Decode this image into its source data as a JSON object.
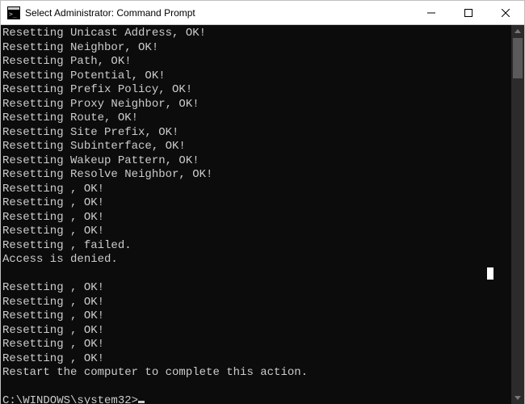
{
  "titlebar": {
    "title": "Select Administrator: Command Prompt"
  },
  "console": {
    "lines": [
      "Resetting Unicast Address, OK!",
      "Resetting Neighbor, OK!",
      "Resetting Path, OK!",
      "Resetting Potential, OK!",
      "Resetting Prefix Policy, OK!",
      "Resetting Proxy Neighbor, OK!",
      "Resetting Route, OK!",
      "Resetting Site Prefix, OK!",
      "Resetting Subinterface, OK!",
      "Resetting Wakeup Pattern, OK!",
      "Resetting Resolve Neighbor, OK!",
      "Resetting , OK!",
      "Resetting , OK!",
      "Resetting , OK!",
      "Resetting , OK!",
      "Resetting , failed.",
      "Access is denied.",
      "",
      "Resetting , OK!",
      "Resetting , OK!",
      "Resetting , OK!",
      "Resetting , OK!",
      "Resetting , OK!",
      "Resetting , OK!",
      "Restart the computer to complete this action.",
      ""
    ],
    "prompt": "C:\\WINDOWS\\system32>"
  }
}
